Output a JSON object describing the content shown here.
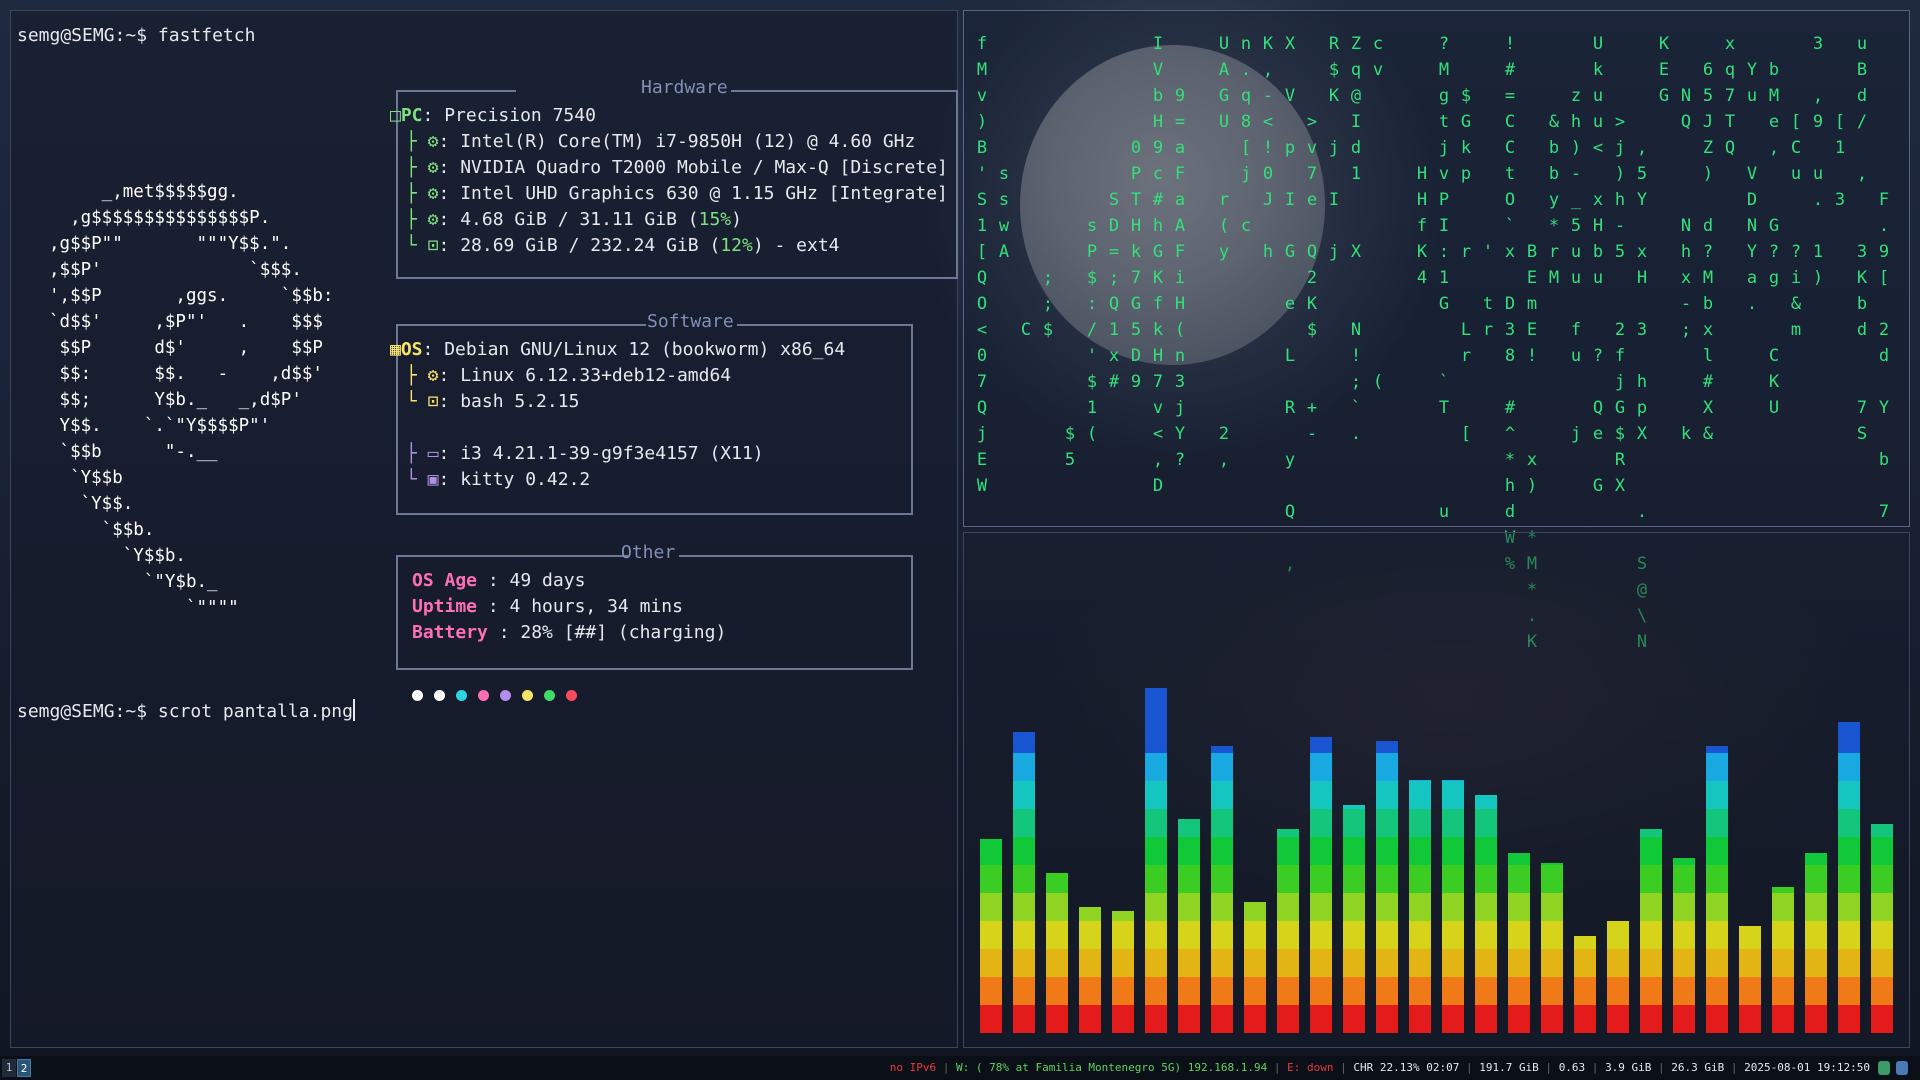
{
  "terminal": {
    "prompt": "semg@SEMG:~$",
    "command1": "fastfetch",
    "command2": "scrot pantalla.png"
  },
  "logo_lines": [
    "     _,met$$$$$gg.",
    "  ,g$$$$$$$$$$$$$$$P.",
    ",g$$P\"\"       \"\"\"Y$$.\".",
    ",$$P'              `$$$.",
    "',$$P       ,ggs.     `$$b:",
    "`d$$'     ,$P\"'   .    $$$",
    " $$P      d$'     ,    $$P",
    " $$:      $$.   -    ,d$$'",
    " $$;      Y$b._   _,d$P'",
    " Y$$.    `.`\"Y$$$$P\"'",
    " `$$b      \"-.__",
    "  `Y$$b",
    "   `Y$$.",
    "     `$$b.",
    "       `Y$$b.",
    "         `\"Y$b._",
    "             `\"\"\"\""
  ],
  "fastfetch": {
    "hardware": {
      "title": "Hardware",
      "pc_key": "PC",
      "pc_value": "Precision 7540",
      "cpu": "Intel(R) Core(TM) i7-9850H (12) @ 4.60 GHz",
      "gpu1": "NVIDIA Quadro T2000 Mobile / Max-Q [Discrete]",
      "gpu2": "Intel UHD Graphics 630 @ 1.15 GHz [Integrate]",
      "memory_pre": "4.68 GiB / 31.11 GiB (",
      "memory_pct": "15%",
      "memory_post": ")",
      "disk_pre": "28.69 GiB / 232.24 GiB (",
      "disk_pct": "12%",
      "disk_post": ") - ext4"
    },
    "software": {
      "title": "Software",
      "os_key": "OS",
      "os_value": "Debian GNU/Linux 12 (bookworm) x86_64",
      "kernel": "Linux 6.12.33+deb12-amd64",
      "shell": "bash 5.2.15",
      "wm": "i3 4.21.1-39-g9f3e4157 (X11)",
      "terminal": "kitty 0.42.2"
    },
    "other": {
      "title": "Other",
      "os_age_key": "OS Age",
      "os_age_value": "49 days",
      "uptime_key": "Uptime",
      "uptime_value": "4 hours, 34 mins",
      "battery_key": "Battery",
      "battery_value": "28% [##] (charging)"
    },
    "color_dots": [
      "#ffffff",
      "#ffffff",
      "#2ad4e0",
      "#ff6fb5",
      "#b58cf0",
      "#f6e36a",
      "#3ddc6a",
      "#ff4b5c"
    ]
  },
  "matrix_columns": [
    "fMv)B'S1[QO<07QjEW",
    "     sswA",
    "           C",
    "         ;;$",
    "               $5",
    "       sP$:/'$1(",
    "      SD=;Q1x#",
    "    0PTHk7G5D9",
    "IVbH9c#hGKfkH7v<,D",
    "  9=aFaAFiH(n3jY?",
    "",
    "UAGU  r(y      2,",
    "n.q8[j c",
    "K,-<!0J h",
    "X V p I G e L R y Q ,",
    "   >v7e Q2K$  +-",
    "R$K j I j",
    "Zq@Id1  X  N!;`.",
    "cv           (",
    "",
    "     HHfK4",
    "?MgtjvPI:1G  `T   u",
    "  $Gkp  r  Lr  [",
    "        ' tr",
    "!#=CCtO`x D38 #^*hdW%",
    "        BEmE!   x) *M*.K",
    "   &bby*rM",
    "  zh)-_5uu fu  j",
    "Ukuu< xHbu  ? Qe G",
    "   >j)h-5  2fjG$RX ",
    "    ,5Y xH 3 hpX  . S@\\N",
    "KEG",
    "  NQ   Nhx-;   k",
    " 65JZ) d?Mbxl#X&",
    "xq7TQ",
    " Yu  VDNYa. ",
    " bMe,  G?g  CKU",
    "   [Cu  ?i&m",
    "3 ,9 u. 1)",
    "   [1 3  ",
    "uBd/ ,  3Kbd  7S",
    "      F.9[ 2d Y b 7"
  ],
  "visualizer": {
    "levels": [
      0.4,
      0.62,
      0.33,
      0.26,
      0.25,
      0.71,
      0.44,
      0.59,
      0.27,
      0.42,
      0.61,
      0.47,
      0.6,
      0.52,
      0.52,
      0.49,
      0.37,
      0.35,
      0.2,
      0.23,
      0.42,
      0.36,
      0.59,
      0.22,
      0.3,
      0.37,
      0.64,
      0.43
    ],
    "colors": [
      "#e41b1b",
      "#f07a18",
      "#e2b515",
      "#d6d31b",
      "#8fd323",
      "#3ccd24",
      "#11c938",
      "#13c67c",
      "#14c6bf",
      "#17a9e0",
      "#1a55d1"
    ]
  },
  "statusbar": {
    "workspaces": [
      "1",
      "2"
    ],
    "active_workspace": "2",
    "ipv6": "no IPv6",
    "wifi": "W: ( 78% at Familia Montenegro 5G) 192.168.1.94",
    "ethernet": "E: down",
    "battery": "CHR 22.13% 02:07",
    "disk": "191.7 GiB",
    "load": "0.63",
    "memory": "3.9 GiB",
    "memory_total": "26.3 GiB",
    "datetime": "2025-08-01 19:12:50",
    "tray_icons": [
      "network-icon",
      "volume-icon"
    ]
  }
}
